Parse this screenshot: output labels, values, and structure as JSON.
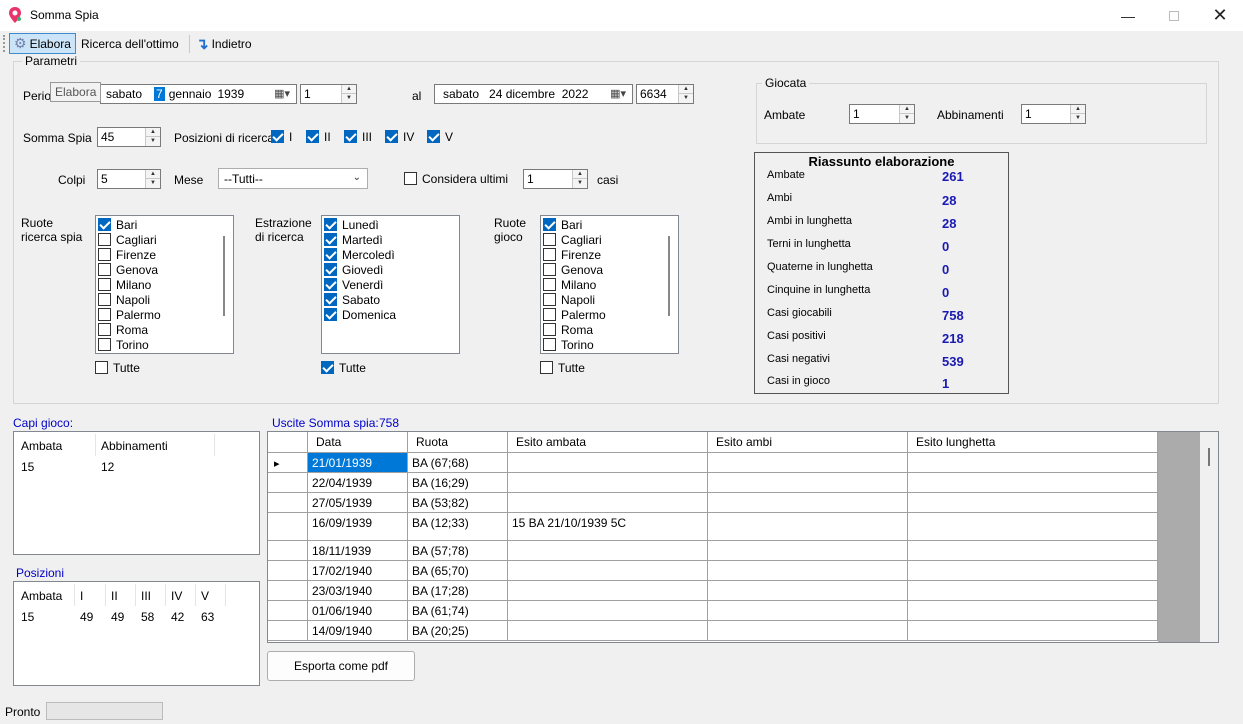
{
  "window": {
    "title": "Somma Spia"
  },
  "toolbar": {
    "elabora": "Elabora",
    "ricerca": "Ricerca dell'ottimo",
    "indietro": "Indietro"
  },
  "tooltip": "Elabora",
  "params": {
    "title": "Parametri",
    "periodo_label": "Perio",
    "date_from": {
      "dow": "sabato",
      "day": "7",
      "month": "gennaio",
      "year": "1939"
    },
    "from_num": "1",
    "al_label": "al",
    "date_to": "sabato   24 dicembre  2022",
    "to_num": "6634",
    "somma_spia_label": "Somma Spia",
    "somma_spia_value": "45",
    "posizioni_label": "Posizioni di ricerca",
    "posizioni": [
      "I",
      "II",
      "III",
      "IV",
      "V"
    ],
    "colpi_label": "Colpi",
    "colpi_value": "5",
    "mese_label": "Mese",
    "mese_value": "--Tutti--",
    "considera_label": "Considera ultimi",
    "considera_value": "1",
    "casi_label": "casi",
    "ruote_ricerca_label1": "Ruote",
    "ruote_ricerca_label2": "ricerca spia",
    "estrazione_label1": "Estrazione",
    "estrazione_label2": "di ricerca",
    "ruote_gioco_label1": "Ruote",
    "ruote_gioco_label2": "gioco",
    "ruote": [
      "Bari",
      "Cagliari",
      "Firenze",
      "Genova",
      "Milano",
      "Napoli",
      "Palermo",
      "Roma",
      "Torino"
    ],
    "giorni": [
      "Lunedì",
      "Martedì",
      "Mercoledì",
      "Giovedì",
      "Venerdì",
      "Sabato",
      "Domenica"
    ],
    "tutte": "Tutte"
  },
  "giocata": {
    "title": "Giocata",
    "ambate_label": "Ambate",
    "ambate_value": "1",
    "abbinamenti_label": "Abbinamenti",
    "abbinamenti_value": "1"
  },
  "riassunto": {
    "title": "Riassunto elaborazione",
    "rows": [
      {
        "label": "Ambate",
        "value": "261"
      },
      {
        "label": "Ambi",
        "value": "28"
      },
      {
        "label": "Ambi in lunghetta",
        "value": "28"
      },
      {
        "label": "Terni in lunghetta",
        "value": "0"
      },
      {
        "label": "Quaterne in lunghetta",
        "value": "0"
      },
      {
        "label": "Cinquine in lunghetta",
        "value": "0"
      },
      {
        "label": "Casi giocabili",
        "value": "758"
      },
      {
        "label": "Casi positivi",
        "value": "218"
      },
      {
        "label": "Casi negativi",
        "value": "539"
      },
      {
        "label": "Casi in gioco",
        "value": "1"
      }
    ]
  },
  "capi_gioco": {
    "title": "Capi gioco:",
    "headers": [
      "Ambata",
      "Abbinamenti"
    ],
    "rows": [
      [
        "15",
        "12"
      ]
    ]
  },
  "posizioni_table": {
    "title": "Posizioni",
    "headers": [
      "Ambata",
      "I",
      "II",
      "III",
      "IV",
      "V"
    ],
    "rows": [
      [
        "15",
        "49",
        "49",
        "58",
        "42",
        "63"
      ]
    ]
  },
  "uscite": {
    "label": "Uscite Somma spia:",
    "count": "758",
    "headers": [
      "Data",
      "Ruota",
      "Esito ambata",
      "Esito ambi",
      "Esito lunghetta"
    ],
    "rows": [
      [
        "21/01/1939",
        "BA (67;68)",
        "",
        "",
        ""
      ],
      [
        "22/04/1939",
        "BA (16;29)",
        "",
        "",
        ""
      ],
      [
        "27/05/1939",
        "BA (53;82)",
        "",
        "",
        ""
      ],
      [
        "16/09/1939",
        "BA (12;33)",
        "15 BA  21/10/1939  5C",
        "",
        ""
      ],
      [
        "18/11/1939",
        "BA (57;78)",
        "",
        "",
        ""
      ],
      [
        "17/02/1940",
        "BA (65;70)",
        "",
        "",
        ""
      ],
      [
        "23/03/1940",
        "BA (17;28)",
        "",
        "",
        ""
      ],
      [
        "01/06/1940",
        "BA (61;74)",
        "",
        "",
        ""
      ],
      [
        "14/09/1940",
        "BA (20;25)",
        "",
        "",
        ""
      ]
    ]
  },
  "export_button": "Esporta come pdf",
  "status": {
    "text": "Pronto"
  }
}
